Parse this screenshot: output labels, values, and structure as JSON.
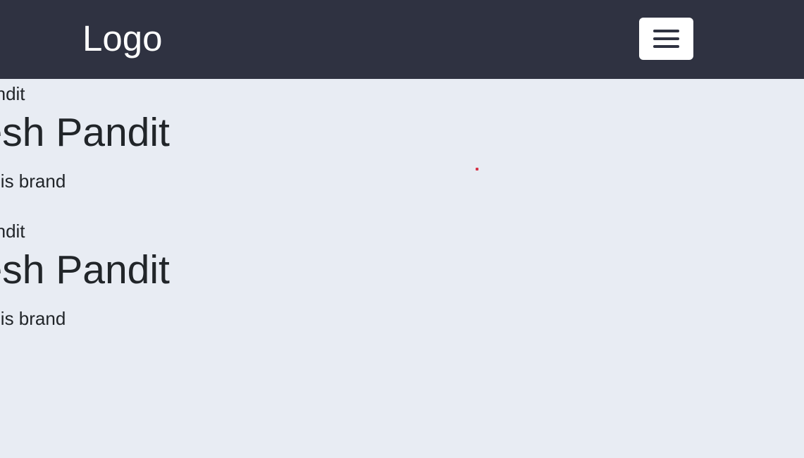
{
  "navbar": {
    "logo": "Logo",
    "menu_toggle_icon": "hamburger-menu-icon",
    "background_color": "#2f3241"
  },
  "page": {
    "background_color": "#e8ecf3",
    "accent_dot_color": "#d63347"
  },
  "cards": [
    {
      "subtitle": "n pandit",
      "title": "kesh Pandit",
      "tagline": "ame is brand"
    },
    {
      "subtitle": "n pandit",
      "title": "kesh Pandit",
      "tagline": "ame is brand"
    }
  ]
}
